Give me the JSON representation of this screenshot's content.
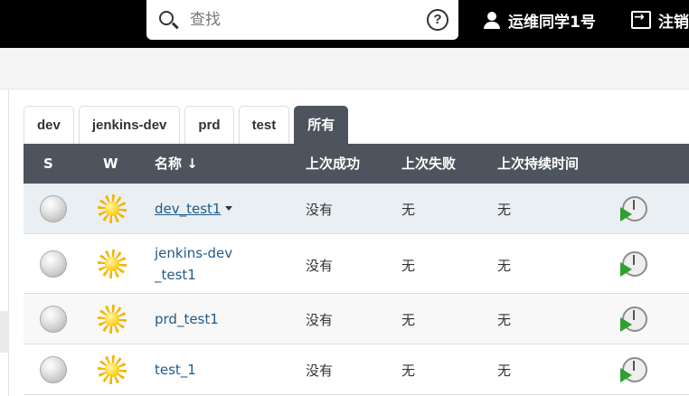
{
  "header": {
    "search_placeholder": "查找",
    "help_label": "?",
    "user_name": "运维同学1号",
    "logout_label": "注销"
  },
  "tabs": [
    {
      "label": "dev",
      "active": false
    },
    {
      "label": "jenkins-dev",
      "active": false
    },
    {
      "label": "prd",
      "active": false
    },
    {
      "label": "test",
      "active": false
    },
    {
      "label": "所有",
      "active": true
    }
  ],
  "table": {
    "headers": {
      "s": "S",
      "w": "W",
      "name": "名称 ↓",
      "last_success": "上次成功",
      "last_failure": "上次失败",
      "last_duration": "上次持续时间"
    },
    "rows": [
      {
        "status_icon": "grey-ball-icon",
        "weather_icon": "sunny-icon",
        "name": "dev_test1",
        "last_success": "没有",
        "last_failure": "无",
        "last_duration": "无"
      },
      {
        "status_icon": "grey-ball-icon",
        "weather_icon": "sunny-icon",
        "name_line1": "jenkins-dev",
        "name_line2": "_test1",
        "last_success": "没有",
        "last_failure": "无",
        "last_duration": "无"
      },
      {
        "status_icon": "grey-ball-icon",
        "weather_icon": "sunny-icon",
        "name": "prd_test1",
        "last_success": "没有",
        "last_failure": "无",
        "last_duration": "无"
      },
      {
        "status_icon": "grey-ball-icon",
        "weather_icon": "sunny-icon",
        "name": "test_1",
        "last_success": "没有",
        "last_failure": "无",
        "last_duration": "无"
      }
    ]
  },
  "colors": {
    "header_bg": "#000000",
    "table_header_bg": "#4d545d",
    "link": "#1f5b8a",
    "highlight_row": "#e9eff3"
  }
}
